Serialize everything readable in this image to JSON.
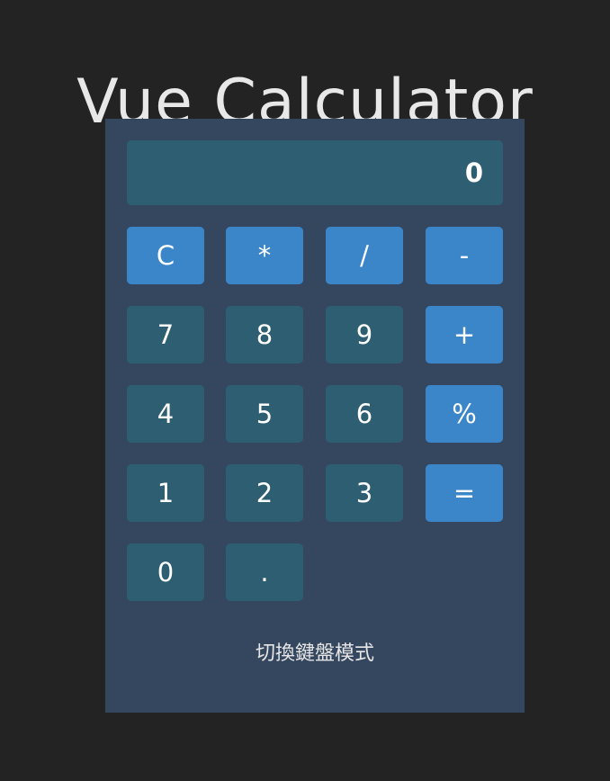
{
  "title": "Vue Calculator",
  "display": {
    "value": "0"
  },
  "buttons": {
    "clear": "C",
    "multiply": "*",
    "divide": "/",
    "subtract": "-",
    "seven": "7",
    "eight": "8",
    "nine": "9",
    "add": "+",
    "four": "4",
    "five": "5",
    "six": "6",
    "percent": "%",
    "one": "1",
    "two": "2",
    "three": "3",
    "equals": "=",
    "zero": "0",
    "decimal": "."
  },
  "toggle_label": "切換鍵盤模式",
  "colors": {
    "background": "#232323",
    "panel": "#35475e",
    "display": "#2e5e72",
    "number_button": "#2e5e72",
    "operator_button": "#3a86c9"
  }
}
